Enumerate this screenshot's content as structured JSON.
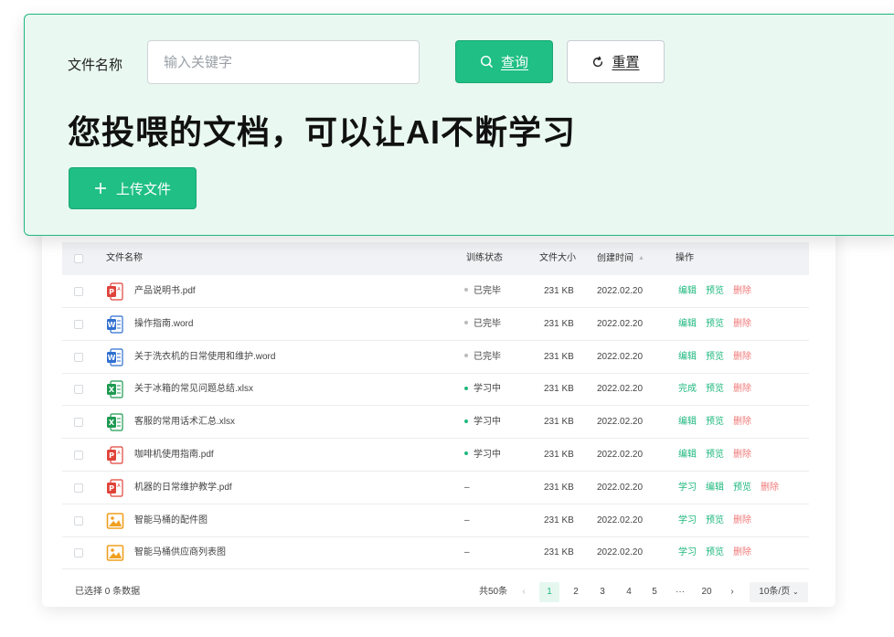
{
  "search": {
    "label": "文件名称",
    "placeholder": "输入关键字",
    "query_label": "查询",
    "reset_label": "重置"
  },
  "headline": "您投喂的文档，可以让AI不断学习",
  "upload_label": "上传文件",
  "table": {
    "headers": {
      "name": "文件名称",
      "status": "训练状态",
      "size": "文件大小",
      "created": "创建时间",
      "actions": "操作"
    },
    "rows": [
      {
        "icon": "pdf",
        "name": "产品说明书.pdf",
        "status": "已完毕",
        "status_color": "#bbbbbb",
        "size": "231 KB",
        "date": "2022.02.20",
        "actions": [
          {
            "label": "编辑",
            "color": "green"
          },
          {
            "label": "预览",
            "color": "green"
          },
          {
            "label": "删除",
            "color": "red"
          }
        ]
      },
      {
        "icon": "word",
        "name": "操作指南.word",
        "status": "已完毕",
        "status_color": "#bbbbbb",
        "size": "231 KB",
        "date": "2022.02.20",
        "actions": [
          {
            "label": "编辑",
            "color": "green"
          },
          {
            "label": "预览",
            "color": "green"
          },
          {
            "label": "删除",
            "color": "red"
          }
        ]
      },
      {
        "icon": "word",
        "name": "关于洗衣机的日常使用和维护.word",
        "status": "已完毕",
        "status_color": "#bbbbbb",
        "size": "231 KB",
        "date": "2022.02.20",
        "actions": [
          {
            "label": "编辑",
            "color": "green"
          },
          {
            "label": "预览",
            "color": "green"
          },
          {
            "label": "删除",
            "color": "red"
          }
        ]
      },
      {
        "icon": "excel",
        "name": "关于冰箱的常见问题总结.xlsx",
        "status": "学习中",
        "status_color": "#1fb87e",
        "size": "231 KB",
        "date": "2022.02.20",
        "actions": [
          {
            "label": "完成",
            "color": "green"
          },
          {
            "label": "预览",
            "color": "green"
          },
          {
            "label": "删除",
            "color": "red"
          }
        ]
      },
      {
        "icon": "excel",
        "name": "客服的常用话术汇总.xlsx",
        "status": "学习中",
        "status_color": "#1fb87e",
        "size": "231 KB",
        "date": "2022.02.20",
        "actions": [
          {
            "label": "编辑",
            "color": "green"
          },
          {
            "label": "预览",
            "color": "green"
          },
          {
            "label": "删除",
            "color": "red"
          }
        ]
      },
      {
        "icon": "pdf",
        "name": "咖啡机使用指南.pdf",
        "status": "学习中",
        "status_color": "#1fb87e",
        "size": "231 KB",
        "date": "2022.02.20",
        "actions": [
          {
            "label": "编辑",
            "color": "green"
          },
          {
            "label": "预览",
            "color": "green"
          },
          {
            "label": "删除",
            "color": "red"
          }
        ]
      },
      {
        "icon": "pdf",
        "name": "机器的日常维护教学.pdf",
        "status": "–",
        "status_color": "",
        "size": "231 KB",
        "date": "2022.02.20",
        "actions": [
          {
            "label": "学习",
            "color": "green"
          },
          {
            "label": "编辑",
            "color": "green"
          },
          {
            "label": "预览",
            "color": "green"
          },
          {
            "label": "删除",
            "color": "red"
          }
        ]
      },
      {
        "icon": "image",
        "name": "智能马桶的配件图",
        "status": "–",
        "status_color": "",
        "size": "231 KB",
        "date": "2022.02.20",
        "actions": [
          {
            "label": "学习",
            "color": "green"
          },
          {
            "label": "预览",
            "color": "green"
          },
          {
            "label": "删除",
            "color": "red"
          }
        ]
      },
      {
        "icon": "image",
        "name": "智能马桶供应商列表图",
        "status": "–",
        "status_color": "",
        "size": "231 KB",
        "date": "2022.02.20",
        "actions": [
          {
            "label": "学习",
            "color": "green"
          },
          {
            "label": "预览",
            "color": "green"
          },
          {
            "label": "删除",
            "color": "red"
          }
        ]
      }
    ]
  },
  "footer": {
    "selected_text": "已选择 0 条数据",
    "total_text": "共50条",
    "pages": [
      "1",
      "2",
      "3",
      "4",
      "5",
      "···",
      "20"
    ],
    "active_page": "1",
    "page_size": "10条/页"
  },
  "colors": {
    "accent": "#1fbf85",
    "delete": "#f07878",
    "card_bg": "#e9f8f1",
    "pdf": "#e0433b",
    "word": "#2f6fd0",
    "excel": "#1e9a52",
    "image": "#f0a020"
  }
}
